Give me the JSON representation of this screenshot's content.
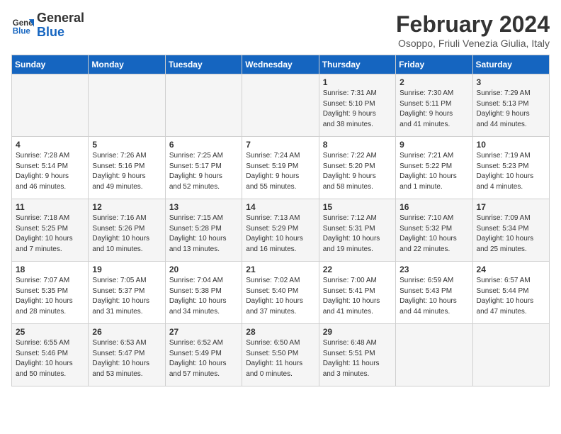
{
  "header": {
    "logo_general": "General",
    "logo_blue": "Blue",
    "month_title": "February 2024",
    "location": "Osoppo, Friuli Venezia Giulia, Italy"
  },
  "weekdays": [
    "Sunday",
    "Monday",
    "Tuesday",
    "Wednesday",
    "Thursday",
    "Friday",
    "Saturday"
  ],
  "weeks": [
    [
      {
        "day": "",
        "content": ""
      },
      {
        "day": "",
        "content": ""
      },
      {
        "day": "",
        "content": ""
      },
      {
        "day": "",
        "content": ""
      },
      {
        "day": "1",
        "content": "Sunrise: 7:31 AM\nSunset: 5:10 PM\nDaylight: 9 hours\nand 38 minutes."
      },
      {
        "day": "2",
        "content": "Sunrise: 7:30 AM\nSunset: 5:11 PM\nDaylight: 9 hours\nand 41 minutes."
      },
      {
        "day": "3",
        "content": "Sunrise: 7:29 AM\nSunset: 5:13 PM\nDaylight: 9 hours\nand 44 minutes."
      }
    ],
    [
      {
        "day": "4",
        "content": "Sunrise: 7:28 AM\nSunset: 5:14 PM\nDaylight: 9 hours\nand 46 minutes."
      },
      {
        "day": "5",
        "content": "Sunrise: 7:26 AM\nSunset: 5:16 PM\nDaylight: 9 hours\nand 49 minutes."
      },
      {
        "day": "6",
        "content": "Sunrise: 7:25 AM\nSunset: 5:17 PM\nDaylight: 9 hours\nand 52 minutes."
      },
      {
        "day": "7",
        "content": "Sunrise: 7:24 AM\nSunset: 5:19 PM\nDaylight: 9 hours\nand 55 minutes."
      },
      {
        "day": "8",
        "content": "Sunrise: 7:22 AM\nSunset: 5:20 PM\nDaylight: 9 hours\nand 58 minutes."
      },
      {
        "day": "9",
        "content": "Sunrise: 7:21 AM\nSunset: 5:22 PM\nDaylight: 10 hours\nand 1 minute."
      },
      {
        "day": "10",
        "content": "Sunrise: 7:19 AM\nSunset: 5:23 PM\nDaylight: 10 hours\nand 4 minutes."
      }
    ],
    [
      {
        "day": "11",
        "content": "Sunrise: 7:18 AM\nSunset: 5:25 PM\nDaylight: 10 hours\nand 7 minutes."
      },
      {
        "day": "12",
        "content": "Sunrise: 7:16 AM\nSunset: 5:26 PM\nDaylight: 10 hours\nand 10 minutes."
      },
      {
        "day": "13",
        "content": "Sunrise: 7:15 AM\nSunset: 5:28 PM\nDaylight: 10 hours\nand 13 minutes."
      },
      {
        "day": "14",
        "content": "Sunrise: 7:13 AM\nSunset: 5:29 PM\nDaylight: 10 hours\nand 16 minutes."
      },
      {
        "day": "15",
        "content": "Sunrise: 7:12 AM\nSunset: 5:31 PM\nDaylight: 10 hours\nand 19 minutes."
      },
      {
        "day": "16",
        "content": "Sunrise: 7:10 AM\nSunset: 5:32 PM\nDaylight: 10 hours\nand 22 minutes."
      },
      {
        "day": "17",
        "content": "Sunrise: 7:09 AM\nSunset: 5:34 PM\nDaylight: 10 hours\nand 25 minutes."
      }
    ],
    [
      {
        "day": "18",
        "content": "Sunrise: 7:07 AM\nSunset: 5:35 PM\nDaylight: 10 hours\nand 28 minutes."
      },
      {
        "day": "19",
        "content": "Sunrise: 7:05 AM\nSunset: 5:37 PM\nDaylight: 10 hours\nand 31 minutes."
      },
      {
        "day": "20",
        "content": "Sunrise: 7:04 AM\nSunset: 5:38 PM\nDaylight: 10 hours\nand 34 minutes."
      },
      {
        "day": "21",
        "content": "Sunrise: 7:02 AM\nSunset: 5:40 PM\nDaylight: 10 hours\nand 37 minutes."
      },
      {
        "day": "22",
        "content": "Sunrise: 7:00 AM\nSunset: 5:41 PM\nDaylight: 10 hours\nand 41 minutes."
      },
      {
        "day": "23",
        "content": "Sunrise: 6:59 AM\nSunset: 5:43 PM\nDaylight: 10 hours\nand 44 minutes."
      },
      {
        "day": "24",
        "content": "Sunrise: 6:57 AM\nSunset: 5:44 PM\nDaylight: 10 hours\nand 47 minutes."
      }
    ],
    [
      {
        "day": "25",
        "content": "Sunrise: 6:55 AM\nSunset: 5:46 PM\nDaylight: 10 hours\nand 50 minutes."
      },
      {
        "day": "26",
        "content": "Sunrise: 6:53 AM\nSunset: 5:47 PM\nDaylight: 10 hours\nand 53 minutes."
      },
      {
        "day": "27",
        "content": "Sunrise: 6:52 AM\nSunset: 5:49 PM\nDaylight: 10 hours\nand 57 minutes."
      },
      {
        "day": "28",
        "content": "Sunrise: 6:50 AM\nSunset: 5:50 PM\nDaylight: 11 hours\nand 0 minutes."
      },
      {
        "day": "29",
        "content": "Sunrise: 6:48 AM\nSunset: 5:51 PM\nDaylight: 11 hours\nand 3 minutes."
      },
      {
        "day": "",
        "content": ""
      },
      {
        "day": "",
        "content": ""
      }
    ]
  ]
}
